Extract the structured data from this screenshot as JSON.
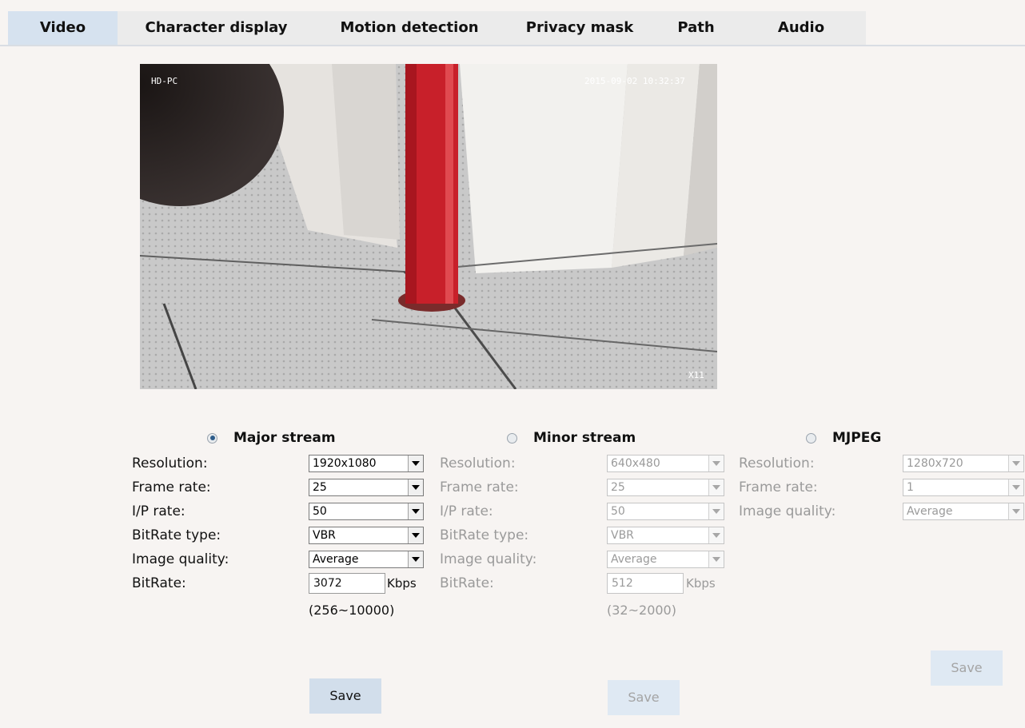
{
  "tabs": [
    "Video",
    "Character display",
    "Motion detection",
    "Privacy mask",
    "Path",
    "Audio"
  ],
  "video": {
    "osd_name": "HD-PC",
    "osd_datetime": "2015-09-02 10:32:37",
    "osd_zoom": "X11"
  },
  "major": {
    "title": "Major stream",
    "resolution_label": "Resolution:",
    "resolution": "1920x1080",
    "framerate_label": "Frame rate:",
    "framerate": "25",
    "iprate_label": "I/P rate:",
    "iprate": "50",
    "bitratetype_label": "BitRate type:",
    "bitratetype": "VBR",
    "quality_label": "Image quality:",
    "quality": "Average",
    "bitrate_label": "BitRate:",
    "bitrate": "3072",
    "unit": "Kbps",
    "range": "(256~10000)",
    "save": "Save"
  },
  "minor": {
    "title": "Minor stream",
    "resolution_label": "Resolution:",
    "resolution": "640x480",
    "framerate_label": "Frame rate:",
    "framerate": "25",
    "iprate_label": "I/P rate:",
    "iprate": "50",
    "bitratetype_label": "BitRate type:",
    "bitratetype": "VBR",
    "quality_label": "Image quality:",
    "quality": "Average",
    "bitrate_label": "BitRate:",
    "bitrate": "512",
    "unit": "Kbps",
    "range": "(32~2000)",
    "save": "Save"
  },
  "mjpeg": {
    "title": "MJPEG",
    "resolution_label": "Resolution:",
    "resolution": "1280x720",
    "framerate_label": "Frame rate:",
    "framerate": "1",
    "quality_label": "Image quality:",
    "quality": "Average",
    "save": "Save"
  }
}
